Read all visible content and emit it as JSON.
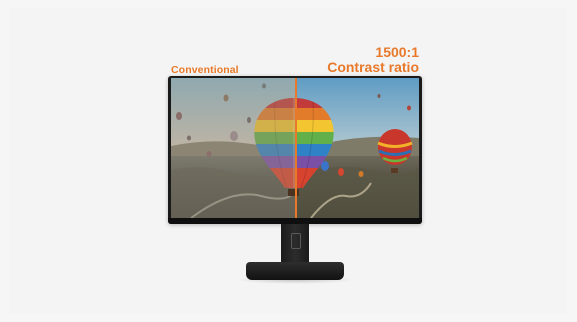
{
  "labels": {
    "left": "Conventional",
    "right_line1": "1500:1",
    "right_line2": "Contrast ratio"
  },
  "colors": {
    "accent": "#e8792a",
    "background": "#f6f6f6",
    "monitor": "#1a1a1a"
  }
}
